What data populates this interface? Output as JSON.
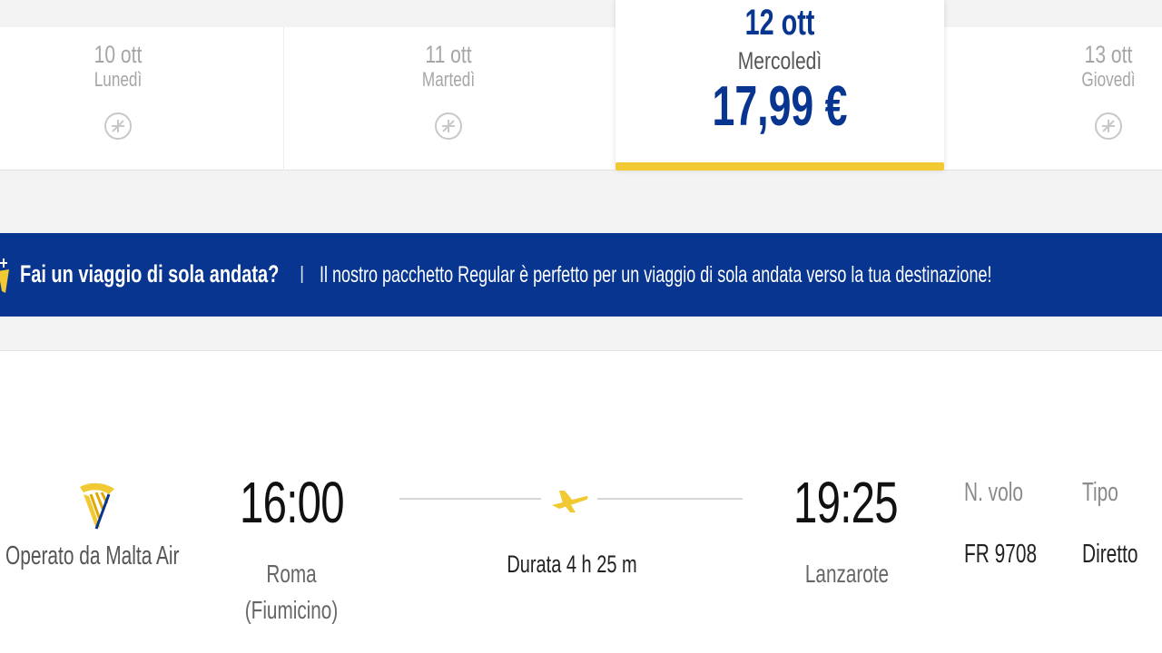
{
  "dates": [
    {
      "date": "10 ott",
      "weekday": "Lunedì"
    },
    {
      "date": "11 ott",
      "weekday": "Martedì"
    },
    {
      "date": "12 ott",
      "weekday": "Mercoledì",
      "price": "17,99 €"
    },
    {
      "date": "13 ott",
      "weekday": "Giovedì"
    }
  ],
  "banner": {
    "title": "Fai un viaggio di sola andata?",
    "divider": "|",
    "text": "Il nostro pacchetto Regular è perfetto per un viaggio di sola andata verso la tua destinazione!"
  },
  "flight": {
    "operated_by": "Operato da Malta Air",
    "departure_time": "16:00",
    "departure_city": "Roma (Fiumicino)",
    "arrival_time": "19:25",
    "arrival_city": "Lanzarote",
    "duration": "Durata 4 h 25 m",
    "flight_number_label": "N. volo",
    "flight_number": "FR 9708",
    "type_label": "Tipo",
    "type": "Diretto"
  },
  "colors": {
    "brand_blue": "#073590",
    "accent_yellow": "#f1c933"
  },
  "icons": [
    "no-flight-icon",
    "info-plane-icon",
    "ryanair-harp-logo",
    "plane-icon"
  ]
}
